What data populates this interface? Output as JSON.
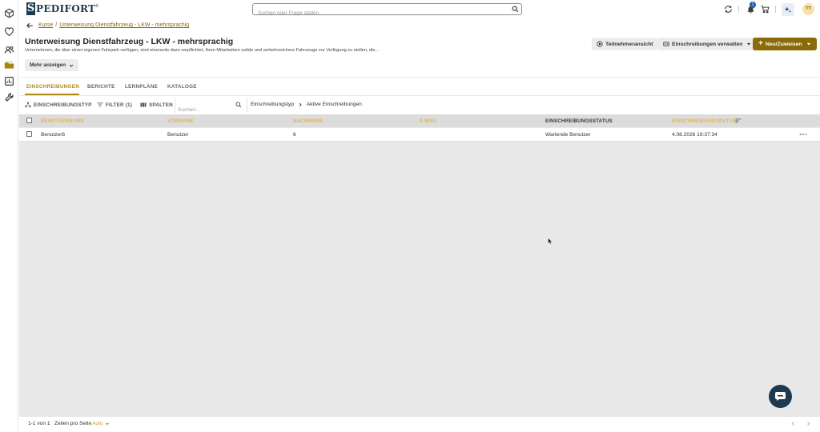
{
  "brand": {
    "logo_letter": "S",
    "logo_text": "PEDIFORT",
    "logo_mark": "®"
  },
  "header": {
    "search_placeholder": "Suchen oder Frage stellen",
    "notification_count": "1",
    "avatar_initials": "TT"
  },
  "rail": [
    "cube-icon",
    "heart-icon",
    "users-icon",
    "courses-icon",
    "reports-icon",
    "tools-icon"
  ],
  "breadcrumb": {
    "root": "Kurse",
    "separator": "/",
    "current": "Unterweisung Dienstfahrzeug - LKW - mehrsprachig"
  },
  "page": {
    "title": "Unterweisung Dienstfahrzeug - LKW - mehrsprachig",
    "description": "Unternehmen, die über einen eigenen Fuhrpark verfügen, sind einerseits dazu verpflichtet, ihren Mitarbeitern solide und verkehrssichere Fahrzeuge zur Verfügung zu stellen, die...",
    "more_label": "Mehr anzeigen"
  },
  "actions": {
    "participant_view": "Teilnehmeransicht",
    "manage_enrollments": "Einschreibungen verwalten",
    "new_assign": "Neu/Zuweisen"
  },
  "tabs": [
    "EINSCHREIBUNGEN",
    "BERICHTE",
    "LERNPLÄNE",
    "KATALOGE"
  ],
  "toolbar": {
    "enrollment_type": "EINSCHREIBUNGSTYP",
    "filter": "FILTER (1)",
    "columns": "SPALTEN",
    "search_placeholder": "Suchen...",
    "crumb_root": "Einschreibungstyp",
    "crumb_current": "Aktive Einschreibungen"
  },
  "table": {
    "headers": [
      "BENUTZERNAME",
      "VORNAME",
      "NACHNAME",
      "E-MAIL",
      "EINSCHREIBUNGSSTATUS",
      "EINSCHREIBUNGSDATUM"
    ],
    "rows": [
      {
        "username": "Benutzer6",
        "first_name": "Benutzer",
        "last_name": "6",
        "email": "",
        "status": "Wartende Benutzer",
        "date": "4.08.2026 16:37:34"
      }
    ]
  },
  "footer": {
    "range": "1-1 von 1",
    "rows_per_page_label": "Zeilen pro Seite",
    "rows_per_page_value": "Auto"
  },
  "colors": {
    "accent": "#8b6b09",
    "accent_light": "#e2b54b",
    "brand": "#1d3b4c"
  }
}
